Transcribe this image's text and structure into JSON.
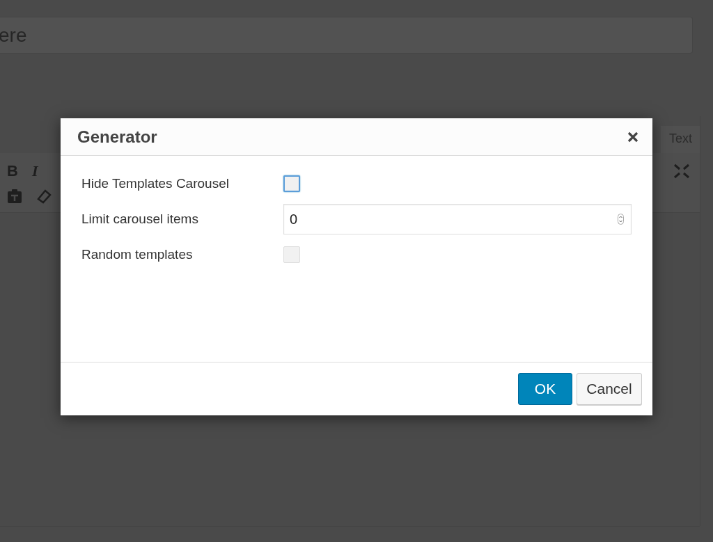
{
  "editor": {
    "title_value": "ere",
    "tab": "Text",
    "toolbar_letters": [
      {
        "label": "B",
        "kind": "bold"
      },
      {
        "label": "I",
        "kind": "italic"
      }
    ]
  },
  "dialog": {
    "title": "Generator",
    "fields": [
      {
        "kind": "checkbox",
        "label": "Hide Templates Carousel",
        "checked": false,
        "focused": true
      },
      {
        "kind": "number",
        "label": "Limit carousel items",
        "value": "0"
      },
      {
        "kind": "checkbox",
        "label": "Random templates",
        "checked": false,
        "focused": false
      }
    ],
    "buttons": [
      {
        "label": "OK",
        "kind": "primary"
      },
      {
        "label": "Cancel",
        "kind": "secondary"
      }
    ]
  }
}
